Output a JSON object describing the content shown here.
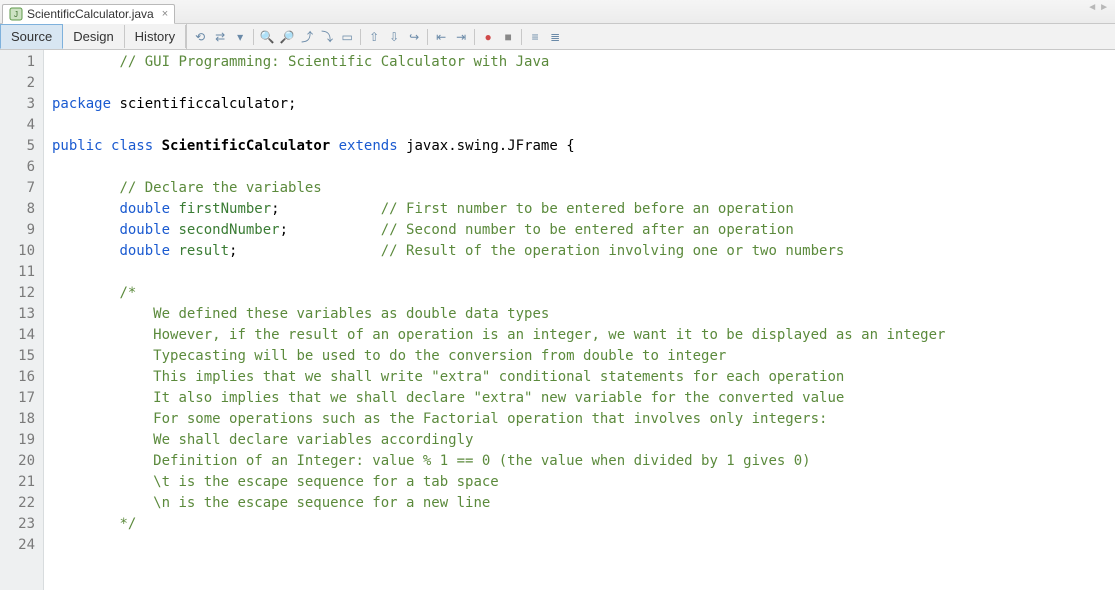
{
  "header": {
    "file_tab_label": "ScientificCalculator.java",
    "nav_prev": "◄",
    "nav_next": "►"
  },
  "view_tabs": {
    "source": "Source",
    "design": "Design",
    "history": "History"
  },
  "toolbar_icons": [
    "refresh-icon",
    "diff-icon",
    "dropdown-icon",
    "sep",
    "find-prev-icon",
    "find-next-icon",
    "bookmark-prev-icon",
    "bookmark-next-icon",
    "select-icon",
    "sep",
    "step-up-icon",
    "step-down-icon",
    "step-over-icon",
    "sep",
    "shift-left-icon",
    "shift-right-icon",
    "sep",
    "record-icon",
    "stop-icon",
    "sep",
    "comment-icon",
    "uncomment-icon"
  ],
  "code": {
    "indent": "    ",
    "lines": [
      {
        "n": 1,
        "seg": [
          [
            "sp2"
          ],
          [
            "cm",
            "// GUI Programming: Scientific Calculator with Java"
          ]
        ]
      },
      {
        "n": 2,
        "seg": []
      },
      {
        "n": 3,
        "seg": [
          [
            "kw",
            "package"
          ],
          [
            "pn",
            " "
          ],
          [
            "pkg",
            "scientificcalculator"
          ],
          [
            "pn",
            ";"
          ]
        ]
      },
      {
        "n": 4,
        "seg": []
      },
      {
        "n": 5,
        "seg": [
          [
            "kw",
            "public"
          ],
          [
            "pn",
            " "
          ],
          [
            "kw",
            "class"
          ],
          [
            "pn",
            " "
          ],
          [
            "cls",
            "ScientificCalculator"
          ],
          [
            "pn",
            " "
          ],
          [
            "kw",
            "extends"
          ],
          [
            "pn",
            " javax.swing.JFrame {"
          ]
        ]
      },
      {
        "n": 6,
        "seg": []
      },
      {
        "n": 7,
        "seg": [
          [
            "sp2"
          ],
          [
            "cm",
            "// Declare the variables"
          ]
        ]
      },
      {
        "n": 8,
        "seg": [
          [
            "sp2"
          ],
          [
            "kw",
            "double"
          ],
          [
            "pn",
            " "
          ],
          [
            "id",
            "firstNumber"
          ],
          [
            "pn",
            ";            "
          ],
          [
            "cm",
            "// First number to be entered before an operation"
          ]
        ]
      },
      {
        "n": 9,
        "seg": [
          [
            "sp2"
          ],
          [
            "kw",
            "double"
          ],
          [
            "pn",
            " "
          ],
          [
            "id",
            "secondNumber"
          ],
          [
            "pn",
            ";           "
          ],
          [
            "cm",
            "// Second number to be entered after an operation"
          ]
        ]
      },
      {
        "n": 10,
        "seg": [
          [
            "sp2"
          ],
          [
            "kw",
            "double"
          ],
          [
            "pn",
            " "
          ],
          [
            "id",
            "result"
          ],
          [
            "pn",
            ";                 "
          ],
          [
            "cm",
            "// Result of the operation involving one or two numbers"
          ]
        ]
      },
      {
        "n": 11,
        "seg": []
      },
      {
        "n": 12,
        "seg": [
          [
            "sp2"
          ],
          [
            "cm",
            "/*"
          ]
        ]
      },
      {
        "n": 13,
        "seg": [
          [
            "sp3"
          ],
          [
            "cm",
            "We defined these variables as double data types"
          ]
        ]
      },
      {
        "n": 14,
        "seg": [
          [
            "sp3"
          ],
          [
            "cm",
            "However, if the result of an operation is an integer, we want it to be displayed as an integer"
          ]
        ]
      },
      {
        "n": 15,
        "seg": [
          [
            "sp3"
          ],
          [
            "cm",
            "Typecasting will be used to do the conversion from double to integer"
          ]
        ]
      },
      {
        "n": 16,
        "seg": [
          [
            "sp3"
          ],
          [
            "cm",
            "This implies that we shall write \"extra\" conditional statements for each operation"
          ]
        ]
      },
      {
        "n": 17,
        "seg": [
          [
            "sp3"
          ],
          [
            "cm",
            "It also implies that we shall declare \"extra\" new variable for the converted value"
          ]
        ]
      },
      {
        "n": 18,
        "seg": [
          [
            "sp3"
          ],
          [
            "cm",
            "For some operations such as the Factorial operation that involves only integers:"
          ]
        ]
      },
      {
        "n": 19,
        "seg": [
          [
            "sp3"
          ],
          [
            "cm",
            "We shall declare variables accordingly"
          ]
        ]
      },
      {
        "n": 20,
        "seg": [
          [
            "sp3"
          ],
          [
            "cm",
            "Definition of an Integer: value % 1 == 0 (the value when divided by 1 gives 0)"
          ]
        ]
      },
      {
        "n": 21,
        "seg": [
          [
            "sp3"
          ],
          [
            "cm",
            "\\t is the escape sequence for a tab space"
          ]
        ]
      },
      {
        "n": 22,
        "seg": [
          [
            "sp3"
          ],
          [
            "cm",
            "\\n is the escape sequence for a new line"
          ]
        ]
      },
      {
        "n": 23,
        "seg": [
          [
            "sp2"
          ],
          [
            "cm",
            "*/"
          ]
        ]
      },
      {
        "n": 24,
        "seg": []
      }
    ]
  }
}
